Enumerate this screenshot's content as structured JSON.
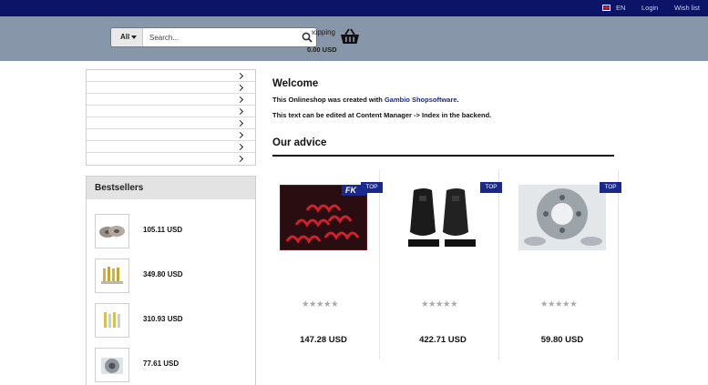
{
  "topbar": {
    "language": "EN",
    "login": "Login",
    "wishlist": "Wish list"
  },
  "search": {
    "category": "All",
    "placeholder": "Search..."
  },
  "cart": {
    "label": "Shopping",
    "total": "0.00 USD"
  },
  "sidebar": {
    "category_items": [
      "",
      "",
      "",
      "",
      "",
      "",
      "",
      ""
    ],
    "bestsellers_title": "Bestsellers",
    "bestsellers": [
      {
        "price": "105.11 USD",
        "icon": "brake-discs-thumb"
      },
      {
        "price": "349.80 USD",
        "icon": "shock-absorbers-thumb"
      },
      {
        "price": "310.93 USD",
        "icon": "suspension-set-thumb"
      },
      {
        "price": "77.61 USD",
        "icon": "wheel-spacer-thumb"
      }
    ]
  },
  "main": {
    "welcome_title": "Welcome",
    "text_prefix": "This Onlineshop was created with ",
    "text_link": "Gambio Shopsoftware",
    "text_suffix": ".",
    "text_line2": "This text can be edited at Content Manager -> Index in the backend.",
    "advice_title": "Our advice",
    "products": [
      {
        "badge": "TOP",
        "price": "147.28 USD",
        "rating_stars": 5,
        "rating_filled": 0,
        "image": "lowering-springs-image",
        "brand_mark": "FK"
      },
      {
        "badge": "TOP",
        "price": "422.71 USD",
        "rating_stars": 5,
        "rating_filled": 0,
        "image": "racing-seats-image"
      },
      {
        "badge": "TOP",
        "price": "59.80 USD",
        "rating_stars": 5,
        "rating_filled": 0,
        "image": "wheel-spacers-image"
      }
    ]
  },
  "colors": {
    "topbar": "#0b1466",
    "header": "#8796a8",
    "accent": "#1a2a8c"
  }
}
